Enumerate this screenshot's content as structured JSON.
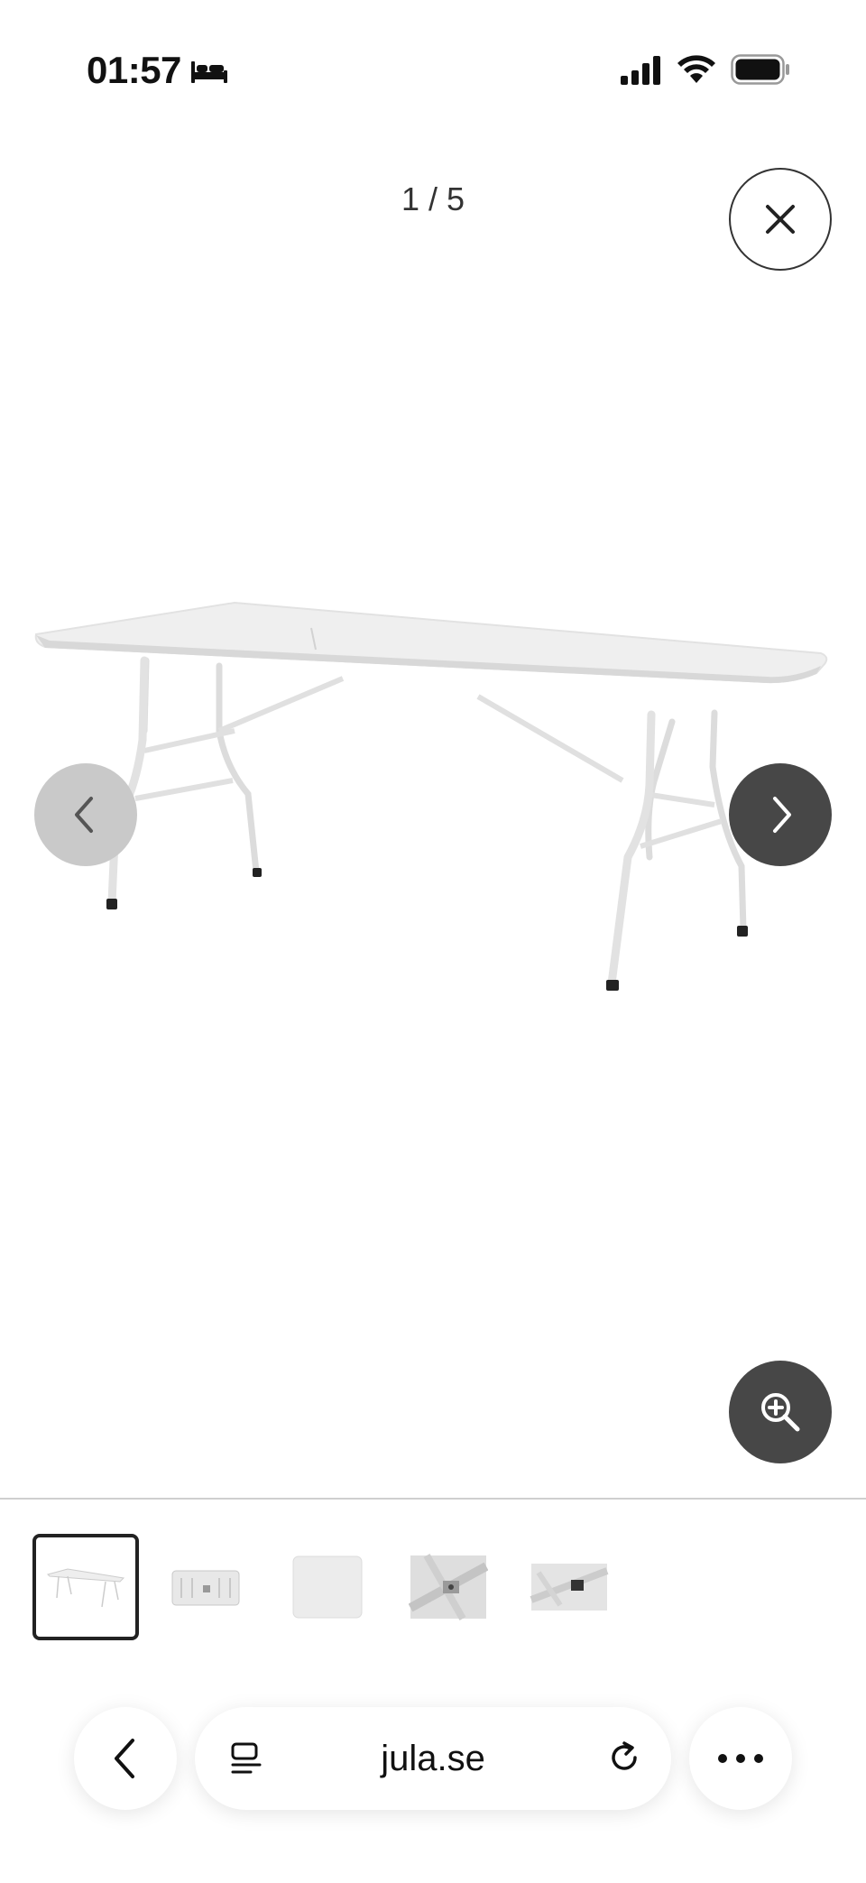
{
  "status_bar": {
    "time": "01:57",
    "sleep_icon": "bed-icon",
    "signal_icon": "cellular-signal-icon",
    "wifi_icon": "wifi-icon",
    "battery_icon": "battery-icon"
  },
  "gallery": {
    "counter": "1 / 5",
    "current_index": 1,
    "total_images": 5,
    "close_icon": "close-icon",
    "prev_icon": "chevron-left-icon",
    "next_icon": "chevron-right-icon",
    "zoom_icon": "zoom-in-icon",
    "thumbnails": [
      {
        "subject": "folding-table-open",
        "selected": true
      },
      {
        "subject": "folding-table-folded",
        "selected": false
      },
      {
        "subject": "table-top-surface",
        "selected": false
      },
      {
        "subject": "hinge-closeup",
        "selected": false
      },
      {
        "subject": "latch-closeup",
        "selected": false
      }
    ]
  },
  "browser": {
    "url": "jula.se",
    "back_icon": "chevron-left-icon",
    "reader_icon": "reader-icon",
    "reload_icon": "reload-icon",
    "more_icon": "more-icon"
  },
  "colors": {
    "nav_dark": "#474747",
    "nav_disabled": "#c9c9c9",
    "table": "#ededed"
  }
}
